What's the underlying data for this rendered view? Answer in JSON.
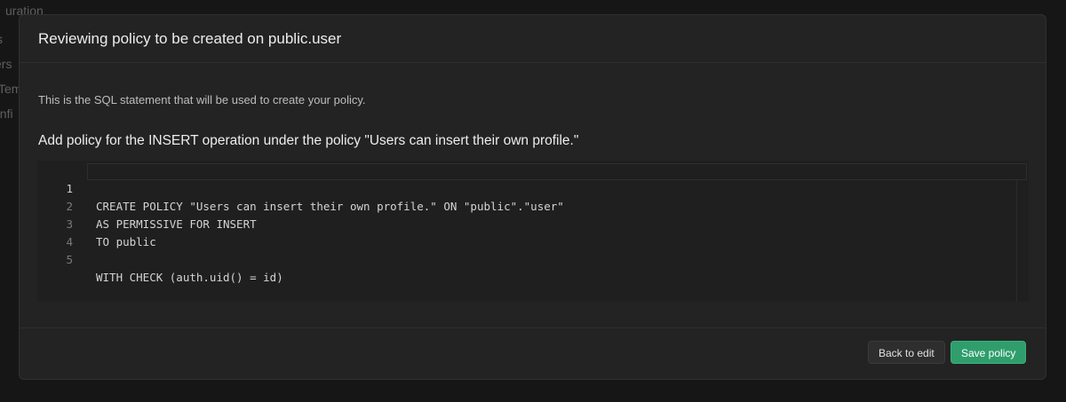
{
  "background": {
    "sidebar_fragments": [
      "uration",
      "s",
      "ers",
      "Tem",
      "onfi"
    ]
  },
  "modal": {
    "title": "Reviewing policy to be created on public.user",
    "description": "This is the SQL statement that will be used to create your policy.",
    "subtitle": "Add policy for the INSERT operation under the policy \"Users can insert their own profile.\"",
    "editor": {
      "active_line": 1,
      "lines": [
        {
          "number": "1",
          "code": "CREATE POLICY \"Users can insert their own profile.\" ON \"public\".\"user\""
        },
        {
          "number": "2",
          "code": "AS PERMISSIVE FOR INSERT"
        },
        {
          "number": "3",
          "code": "TO public"
        },
        {
          "number": "4",
          "code": ""
        },
        {
          "number": "5",
          "code": "WITH CHECK (auth.uid() = id)"
        }
      ]
    },
    "footer": {
      "back_label": "Back to edit",
      "save_label": "Save policy"
    }
  },
  "colors": {
    "primary_button": "#2f9e6c",
    "modal_background": "#232323",
    "editor_background": "#1f1f1f"
  }
}
